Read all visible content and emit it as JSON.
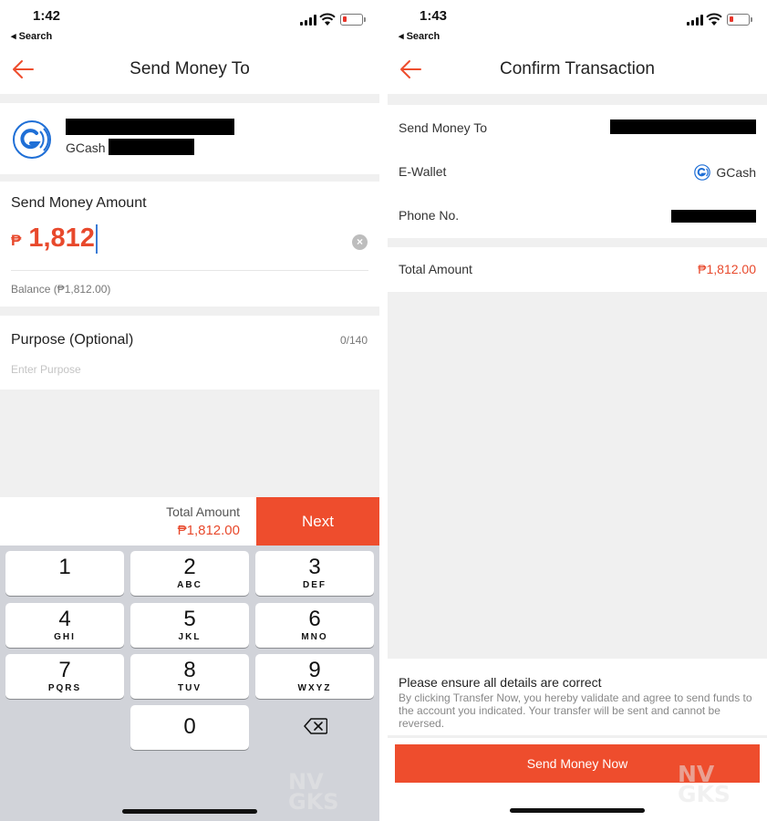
{
  "left_screen": {
    "status": {
      "time": "1:42",
      "back_label": "◂ Search"
    },
    "nav": {
      "title": "Send Money To"
    },
    "recipient": {
      "wallet_label": "GCash"
    },
    "amount_section": {
      "label": "Send Money Amount",
      "currency": "₱",
      "value": "1,812",
      "balance": "Balance (₱1,812.00)"
    },
    "purpose_section": {
      "label": "Purpose (Optional)",
      "counter": "0/140",
      "placeholder": "Enter Purpose"
    },
    "total_bar": {
      "label": "Total Amount",
      "value": "₱1,812.00",
      "next_label": "Next"
    },
    "keypad": {
      "keys": [
        {
          "digit": "1",
          "letters": ""
        },
        {
          "digit": "2",
          "letters": "ABC"
        },
        {
          "digit": "3",
          "letters": "DEF"
        },
        {
          "digit": "4",
          "letters": "GHI"
        },
        {
          "digit": "5",
          "letters": "JKL"
        },
        {
          "digit": "6",
          "letters": "MNO"
        },
        {
          "digit": "7",
          "letters": "PQRS"
        },
        {
          "digit": "8",
          "letters": "TUV"
        },
        {
          "digit": "9",
          "letters": "WXYZ"
        },
        {
          "digit": "0",
          "letters": ""
        }
      ],
      "backspace_icon": "backspace-icon"
    }
  },
  "right_screen": {
    "status": {
      "time": "1:43",
      "back_label": "◂ Search"
    },
    "nav": {
      "title": "Confirm Transaction"
    },
    "details": {
      "send_to_label": "Send Money To",
      "ewallet_label": "E-Wallet",
      "ewallet_value": "GCash",
      "phone_label": "Phone No.",
      "total_label": "Total Amount",
      "total_value": "₱1,812.00"
    },
    "notice": {
      "title": "Please ensure all details are correct",
      "body": "By clicking Transfer Now, you hereby validate and agree to send funds to the account you indicated. Your transfer will be sent and cannot be reversed."
    },
    "send_button_label": "Send Money Now"
  },
  "watermark": {
    "line1": "NV",
    "line2": "GKS"
  },
  "colors": {
    "accent": "#ee4d2d",
    "amount": "#e8492c",
    "background_grey": "#f0f0f0",
    "keypad_bg": "#d1d3d9"
  }
}
